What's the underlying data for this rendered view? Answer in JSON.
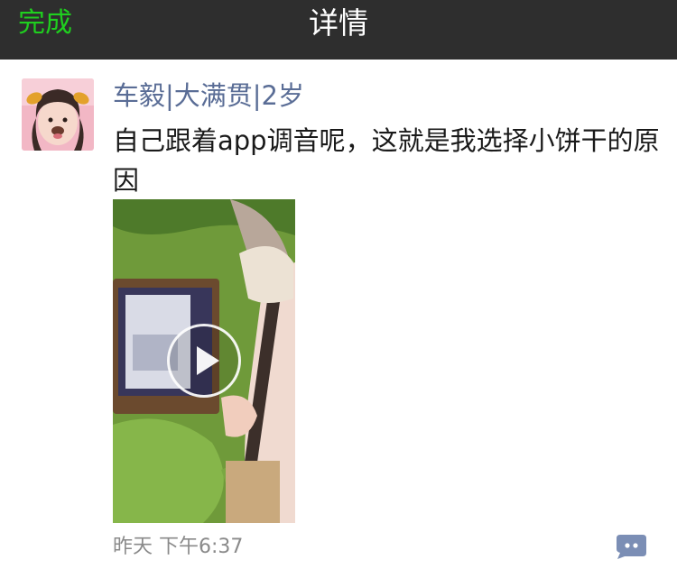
{
  "header": {
    "done_label": "完成",
    "title": "详情"
  },
  "post": {
    "author": "车毅|大满贯|2岁",
    "text": "自己跟着app调音呢，这就是我选择小饼干的原因",
    "time": "昨天 下午6:37"
  },
  "icons": {
    "avatar": "profile-photo",
    "play": "play-icon",
    "comment": "comment-bubble-icon"
  },
  "colors": {
    "nav_background": "#2e2e2e",
    "done_green": "#1fcf1f",
    "name_link": "#5a6d96",
    "comment_icon": "#7b8eb5"
  }
}
